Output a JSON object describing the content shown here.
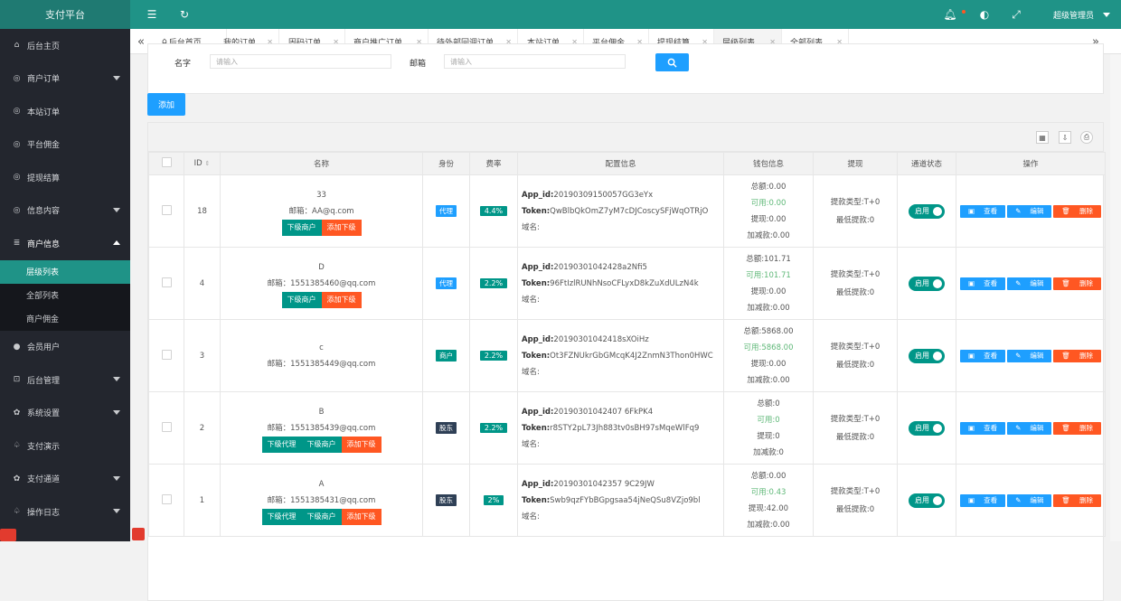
{
  "brand": "支付平台",
  "sidebar": {
    "items": [
      {
        "label": "后台主页",
        "icon": "home-icon",
        "arrow": false
      },
      {
        "label": "商户订单",
        "icon": "cube-icon",
        "arrow": true
      },
      {
        "label": "本站订单",
        "icon": "cube-icon",
        "arrow": false
      },
      {
        "label": "平台佣金",
        "icon": "cube-icon",
        "arrow": false
      },
      {
        "label": "提现结算",
        "icon": "cube-icon",
        "arrow": false
      },
      {
        "label": "信息内容",
        "icon": "cube-icon",
        "arrow": true
      },
      {
        "label": "商户信息",
        "icon": "list-icon",
        "arrow": true,
        "open": true
      },
      {
        "label": "会员用户",
        "icon": "user-icon",
        "arrow": false
      },
      {
        "label": "后台管理",
        "icon": "lock-icon",
        "arrow": true
      },
      {
        "label": "系统设置",
        "icon": "gear-icon",
        "arrow": true
      },
      {
        "label": "支付演示",
        "icon": "bell-icon",
        "arrow": false
      },
      {
        "label": "支付通道",
        "icon": "gear-icon",
        "arrow": true
      },
      {
        "label": "操作日志",
        "icon": "bell-icon",
        "arrow": true
      }
    ],
    "sub_items": [
      "层级列表",
      "全部列表",
      "商户佣金"
    ]
  },
  "topbar": {
    "user": "超级管理员"
  },
  "tabs": [
    "后台首页",
    "我的订单",
    "固码订单",
    "商户推广订单",
    "待外部回调订单",
    "本站订单",
    "平台佣金",
    "提现结算",
    "层级列表",
    "全部列表"
  ],
  "search": {
    "name_label": "名字",
    "name_placeholder": "请输入",
    "email_label": "邮箱",
    "email_placeholder": "请输入"
  },
  "add_button": "添加",
  "table": {
    "headers": [
      "ID",
      "名称",
      "身份",
      "费率",
      "配置信息",
      "钱包信息",
      "提现",
      "通道状态",
      "操作"
    ],
    "rows": [
      {
        "id": "18",
        "name": "33",
        "email": "邮箱：AA@q.com",
        "buttons": [
          {
            "label": "下级商户",
            "color": "g"
          },
          {
            "label": "添加下级",
            "color": "o"
          }
        ],
        "role": "代理",
        "role_color": "b-blue",
        "rate": "4.4%",
        "app_id": "20190309150057GG3eYx",
        "token": "QwBlbQkOmZ7yM7cDJCoscySFjWqOTRjO",
        "total": "总额:0.00",
        "avail": "可用:0.00",
        "withdrawn": "提现:0.00",
        "adjust": "加减款:0.00",
        "wd_type": "提款类型:T+0",
        "wd_min": "最低提款:0",
        "status": "启用"
      },
      {
        "id": "4",
        "name": "D",
        "email": "邮箱：1551385460@qq.com",
        "buttons": [
          {
            "label": "下级商户",
            "color": "g"
          },
          {
            "label": "添加下级",
            "color": "o"
          }
        ],
        "role": "代理",
        "role_color": "b-blue",
        "rate": "2.2%",
        "app_id": "20190301042428a2Nfi5",
        "token": "96FtIzlRUNhNsoCFLyxD8kZuXdULzN4k",
        "total": "总额:101.71",
        "avail": "可用:101.71",
        "withdrawn": "提现:0.00",
        "adjust": "加减款:0.00",
        "wd_type": "提款类型:T+0",
        "wd_min": "最低提款:0",
        "status": "启用"
      },
      {
        "id": "3",
        "name": "c",
        "email": "邮箱：1551385449@qq.com",
        "buttons": [],
        "role": "商户",
        "role_color": "b-green",
        "rate": "2.2%",
        "app_id": "20190301042418sXOiHz",
        "token": "Ot3FZNUkrGbGMcqK4J2ZnmN3Thon0HWC",
        "total": "总额:5868.00",
        "avail": "可用:5868.00",
        "withdrawn": "提现:0.00",
        "adjust": "加减款:0.00",
        "wd_type": "提款类型:T+0",
        "wd_min": "最低提款:0",
        "status": "启用"
      },
      {
        "id": "2",
        "name": "B",
        "email": "邮箱：1551385439@qq.com",
        "buttons": [
          {
            "label": "下级代理",
            "color": "g"
          },
          {
            "label": "下级商户",
            "color": "g"
          },
          {
            "label": "添加下级",
            "color": "o"
          }
        ],
        "role": "股东",
        "role_color": "b-dark",
        "rate": "2.2%",
        "app_id": "20190301042407 6FkPK4",
        "token": "r8STY2pL73Jh883tv0sBH97sMqeWlFq9",
        "total": "总额:0",
        "avail": "可用:0",
        "withdrawn": "提现:0",
        "adjust": "加减款:0",
        "wd_type": "提款类型:T+0",
        "wd_min": "最低提款:0",
        "status": "启用"
      },
      {
        "id": "1",
        "name": "A",
        "email": "邮箱：1551385431@qq.com",
        "buttons": [
          {
            "label": "下级代理",
            "color": "g"
          },
          {
            "label": "下级商户",
            "color": "g"
          },
          {
            "label": "添加下级",
            "color": "o"
          }
        ],
        "role": "股东",
        "role_color": "b-dark",
        "rate": "2%",
        "app_id": "20190301042357 9C29JW",
        "token": "Swb9qzFYbBGpgsaa54jNeQSu8VZjo9bl",
        "total": "总额:0.00",
        "avail": "可用:0.43",
        "withdrawn": "提现:42.00",
        "adjust": "加减款:0.00",
        "wd_type": "提款类型:T+0",
        "wd_min": "最低提款:0",
        "status": "启用"
      }
    ],
    "cfg_app_label": "App_id:",
    "cfg_token_label": "Token:",
    "cfg_domain_label": "域名:",
    "op_view": "查看",
    "op_edit": "编辑",
    "op_delete": "删除"
  }
}
